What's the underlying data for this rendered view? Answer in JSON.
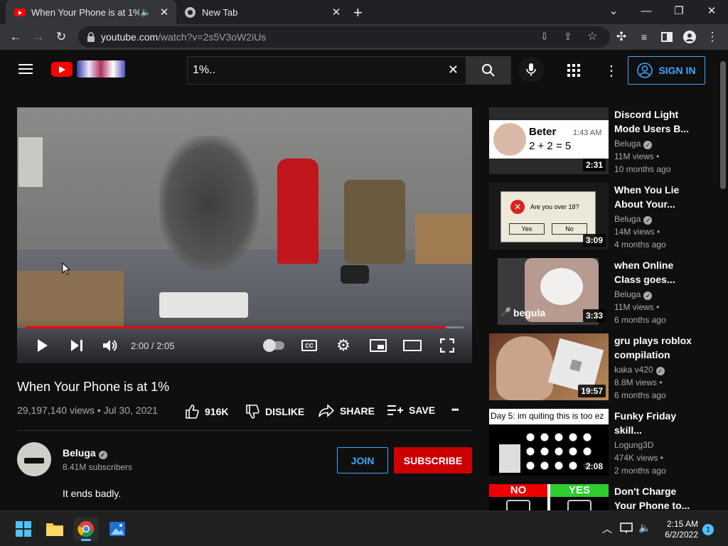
{
  "browser": {
    "tabs": [
      {
        "title": "When Your Phone is at 1% -",
        "active": true
      },
      {
        "title": "New Tab",
        "active": false
      }
    ],
    "new_tab_symbol": "+",
    "url_host": "youtube.com",
    "url_path": "/watch?v=2s5V3oW2iUs"
  },
  "youtube": {
    "search_value": "1%..",
    "sign_in_label": "SIGN IN"
  },
  "player": {
    "time": "2:00 / 2:05",
    "progress": 0.96
  },
  "video": {
    "title": "When Your Phone is at 1%",
    "stats": "29,197,140 views • Jul 30, 2021",
    "likes": "916K",
    "dislike_label": "DISLIKE",
    "share_label": "SHARE",
    "save_label": "SAVE",
    "more_symbol": "•••"
  },
  "channel": {
    "name": "Beluga",
    "subscribers": "8.41M subscribers",
    "join_label": "JOIN",
    "subscribe_label": "SUBSCRIBE",
    "description": "It ends badly."
  },
  "recommendations": [
    {
      "title": "Discord Light Mode Users B...",
      "channel": "Beluga",
      "views": "11M views •",
      "ago": "10 months ago",
      "duration": "2:31",
      "thumb_text": "Beter",
      "thumb_time": "1:43 AM",
      "thumb_eq": "2 + 2 = 5"
    },
    {
      "title": "When You Lie About Your...",
      "channel": "Beluga",
      "views": "14M views •",
      "ago": "4 months ago",
      "duration": "3:09",
      "thumb_text": "Are you over 18?",
      "thumb_yes": "Yes",
      "thumb_no": "No"
    },
    {
      "title": "when Online Class goes...",
      "channel": "Beluga",
      "views": "11M views •",
      "ago": "6 months ago",
      "duration": "3:33",
      "thumb_text": "begula"
    },
    {
      "title": "gru plays roblox compilation",
      "channel": "kaka v420",
      "views": "8.8M views •",
      "ago": "6 months ago",
      "duration": "19:57"
    },
    {
      "title": "Funky Friday skill...",
      "channel": "Logung3D",
      "views": "474K views •",
      "ago": "2 months ago",
      "duration": "2:08",
      "thumb_text": "Day 5: im quiting this is too ez"
    },
    {
      "title": "Don't Charge Your Phone to...",
      "channel": "",
      "views": "",
      "ago": "",
      "duration": "",
      "thumb_no": "NO",
      "thumb_yes": "YES"
    }
  ],
  "taskbar": {
    "time": "2:15 AM",
    "date": "6/2/2022",
    "notifications": "1"
  }
}
